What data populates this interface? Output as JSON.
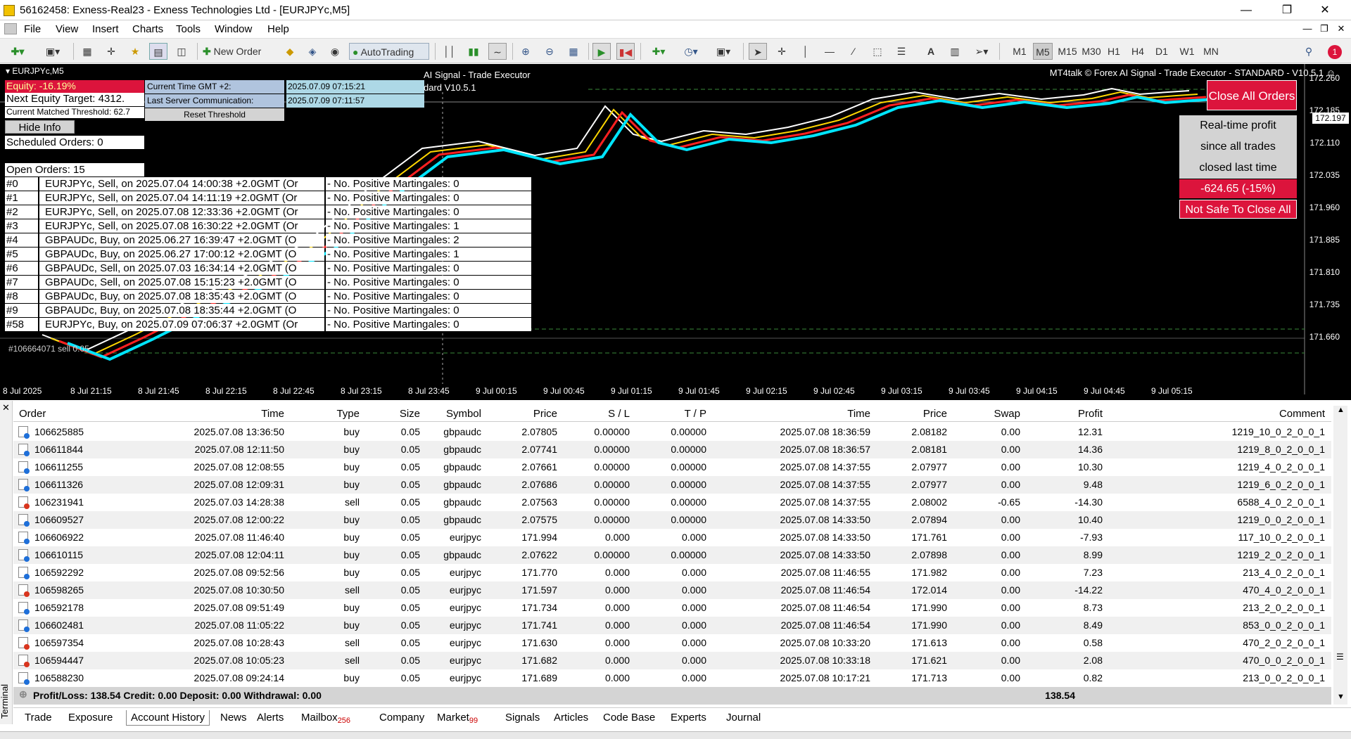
{
  "window": {
    "title": "56162458: Exness-Real23 - Exness Technologies Ltd - [EURJPYc,M5]"
  },
  "menu": [
    "File",
    "View",
    "Insert",
    "Charts",
    "Tools",
    "Window",
    "Help"
  ],
  "toolbar": {
    "new_order": "New Order",
    "autotrading": "AutoTrading",
    "timeframes": [
      "M1",
      "M5",
      "M15",
      "M30",
      "H1",
      "H4",
      "D1",
      "W1",
      "MN"
    ],
    "active_timeframe": "M5",
    "notification_count": "1"
  },
  "chart": {
    "symbol_title": "EURJPYc,M5",
    "header_right": "MT4talk © Forex AI Signal - Trade Executor - STANDARD - V10.5.1",
    "equity": "Equity: -16.19%",
    "next_equity_target": "Next Equity Target: 4312.",
    "current_threshold": "Current Matched Threshold: 62.7",
    "gmt_label": "Current Time GMT +2:",
    "gmt_value": "2025.07.09 07:15:21",
    "server_label": "Last Server Communication:",
    "server_value": "2025.07.09 07:11:57",
    "reset_threshold": "Reset Threshold",
    "ai_signal_title": "AI Signal - Trade Executor",
    "ai_signal_version": "dard V10.5.1",
    "hide_info": "Hide Info",
    "scheduled_orders": "Scheduled Orders: 0",
    "open_orders": "Open Orders: 15",
    "orders": [
      {
        "id": "#0",
        "desc": "EURJPYc, Sell, on 2025.07.04 14:00:38 +2.0GMT  (Or",
        "mart": " - No. Positive Martingales: 0"
      },
      {
        "id": "#1",
        "desc": "EURJPYc, Sell, on 2025.07.04 14:11:19 +2.0GMT  (Or",
        "mart": " - No. Positive Martingales: 0"
      },
      {
        "id": "#2",
        "desc": "EURJPYc, Sell, on 2025.07.08 12:33:36 +2.0GMT  (Or",
        "mart": " - No. Positive Martingales: 0"
      },
      {
        "id": "#3",
        "desc": "EURJPYc, Sell, on 2025.07.08 16:30:22 +2.0GMT  (Or",
        "mart": " - No. Positive Martingales: 1"
      },
      {
        "id": "#4",
        "desc": "GBPAUDc, Buy, on 2025.06.27 16:39:47 +2.0GMT  (O",
        "mart": " - No. Positive Martingales: 2"
      },
      {
        "id": "#5",
        "desc": "GBPAUDc, Buy, on 2025.06.27 17:00:12 +2.0GMT  (O",
        "mart": " - No. Positive Martingales: 1"
      },
      {
        "id": "#6",
        "desc": "GBPAUDc, Sell, on 2025.07.03 16:34:14 +2.0GMT  (O",
        "mart": " - No. Positive Martingales: 0"
      },
      {
        "id": "#7",
        "desc": "GBPAUDc, Sell, on 2025.07.08 15:15:23 +2.0GMT  (O",
        "mart": " - No. Positive Martingales: 0"
      },
      {
        "id": "#8",
        "desc": "GBPAUDc, Buy, on 2025.07.08 18:35:43 +2.0GMT  (O",
        "mart": " - No. Positive Martingales: 0"
      },
      {
        "id": "#9",
        "desc": "GBPAUDc, Buy, on 2025.07.08 18:35:44 +2.0GMT  (O",
        "mart": " - No. Positive Martingales: 0"
      },
      {
        "id": "#58",
        "desc": "EURJPYc, Buy, on 2025.07.09 07:06:37 +2.0GMT  (Or",
        "mart": " - No. Positive Martingales: 0"
      }
    ],
    "close_all_orders": "Close All Orders",
    "realtime_profit_lines": [
      "Real-time profit",
      "since all trades",
      "closed last time"
    ],
    "realtime_profit_value": "-624.65 (-15%)",
    "not_safe": "Not Safe To Close All",
    "current_price": "172.197",
    "price_axis": [
      "172.260",
      "172.185",
      "172.110",
      "172.035",
      "171.960",
      "171.885",
      "171.810",
      "171.735",
      "171.660"
    ],
    "time_axis": [
      "8 Jul 2025",
      "8 Jul 21:15",
      "8 Jul 21:45",
      "8 Jul 22:15",
      "8 Jul 22:45",
      "8 Jul 23:15",
      "8 Jul 23:45",
      "9 Jul 00:15",
      "9 Jul 00:45",
      "9 Jul 01:15",
      "9 Jul 01:45",
      "9 Jul 02:15",
      "9 Jul 02:45",
      "9 Jul 03:15",
      "9 Jul 03:45",
      "9 Jul 04:15",
      "9 Jul 04:45",
      "9 Jul 05:15"
    ],
    "ticket_label": "#106664071 sell 0.05"
  },
  "terminal": {
    "side_label": "Terminal",
    "columns": [
      "Order",
      "Time",
      "Type",
      "Size",
      "Symbol",
      "Price",
      "S / L",
      "T / P",
      "Time",
      "Price",
      "Swap",
      "Profit",
      "Comment"
    ],
    "rows": [
      {
        "order": "106625885",
        "open_time": "2025.07.08 13:36:50",
        "type": "buy",
        "size": "0.05",
        "symbol": "gbpaudc",
        "price": "2.07805",
        "sl": "0.00000",
        "tp": "0.00000",
        "close_time": "2025.07.08 18:36:59",
        "close_price": "2.08182",
        "swap": "0.00",
        "profit": "12.31",
        "comment": "1219_10_0_2_0_0_1"
      },
      {
        "order": "106611844",
        "open_time": "2025.07.08 12:11:50",
        "type": "buy",
        "size": "0.05",
        "symbol": "gbpaudc",
        "price": "2.07741",
        "sl": "0.00000",
        "tp": "0.00000",
        "close_time": "2025.07.08 18:36:57",
        "close_price": "2.08181",
        "swap": "0.00",
        "profit": "14.36",
        "comment": "1219_8_0_2_0_0_1"
      },
      {
        "order": "106611255",
        "open_time": "2025.07.08 12:08:55",
        "type": "buy",
        "size": "0.05",
        "symbol": "gbpaudc",
        "price": "2.07661",
        "sl": "0.00000",
        "tp": "0.00000",
        "close_time": "2025.07.08 14:37:55",
        "close_price": "2.07977",
        "swap": "0.00",
        "profit": "10.30",
        "comment": "1219_4_0_2_0_0_1"
      },
      {
        "order": "106611326",
        "open_time": "2025.07.08 12:09:31",
        "type": "buy",
        "size": "0.05",
        "symbol": "gbpaudc",
        "price": "2.07686",
        "sl": "0.00000",
        "tp": "0.00000",
        "close_time": "2025.07.08 14:37:55",
        "close_price": "2.07977",
        "swap": "0.00",
        "profit": "9.48",
        "comment": "1219_6_0_2_0_0_1"
      },
      {
        "order": "106231941",
        "open_time": "2025.07.03 14:28:38",
        "type": "sell",
        "size": "0.05",
        "symbol": "gbpaudc",
        "price": "2.07563",
        "sl": "0.00000",
        "tp": "0.00000",
        "close_time": "2025.07.08 14:37:55",
        "close_price": "2.08002",
        "swap": "-0.65",
        "profit": "-14.30",
        "comment": "6588_4_0_2_0_0_1"
      },
      {
        "order": "106609527",
        "open_time": "2025.07.08 12:00:22",
        "type": "buy",
        "size": "0.05",
        "symbol": "gbpaudc",
        "price": "2.07575",
        "sl": "0.00000",
        "tp": "0.00000",
        "close_time": "2025.07.08 14:33:50",
        "close_price": "2.07894",
        "swap": "0.00",
        "profit": "10.40",
        "comment": "1219_0_0_2_0_0_1"
      },
      {
        "order": "106606922",
        "open_time": "2025.07.08 11:46:40",
        "type": "buy",
        "size": "0.05",
        "symbol": "eurjpyc",
        "price": "171.994",
        "sl": "0.000",
        "tp": "0.000",
        "close_time": "2025.07.08 14:33:50",
        "close_price": "171.761",
        "swap": "0.00",
        "profit": "-7.93",
        "comment": "117_10_0_2_0_0_1"
      },
      {
        "order": "106610115",
        "open_time": "2025.07.08 12:04:11",
        "type": "buy",
        "size": "0.05",
        "symbol": "gbpaudc",
        "price": "2.07622",
        "sl": "0.00000",
        "tp": "0.00000",
        "close_time": "2025.07.08 14:33:50",
        "close_price": "2.07898",
        "swap": "0.00",
        "profit": "8.99",
        "comment": "1219_2_0_2_0_0_1"
      },
      {
        "order": "106592292",
        "open_time": "2025.07.08 09:52:56",
        "type": "buy",
        "size": "0.05",
        "symbol": "eurjpyc",
        "price": "171.770",
        "sl": "0.000",
        "tp": "0.000",
        "close_time": "2025.07.08 11:46:55",
        "close_price": "171.982",
        "swap": "0.00",
        "profit": "7.23",
        "comment": "213_4_0_2_0_0_1"
      },
      {
        "order": "106598265",
        "open_time": "2025.07.08 10:30:50",
        "type": "sell",
        "size": "0.05",
        "symbol": "eurjpyc",
        "price": "171.597",
        "sl": "0.000",
        "tp": "0.000",
        "close_time": "2025.07.08 11:46:54",
        "close_price": "172.014",
        "swap": "0.00",
        "profit": "-14.22",
        "comment": "470_4_0_2_0_0_1"
      },
      {
        "order": "106592178",
        "open_time": "2025.07.08 09:51:49",
        "type": "buy",
        "size": "0.05",
        "symbol": "eurjpyc",
        "price": "171.734",
        "sl": "0.000",
        "tp": "0.000",
        "close_time": "2025.07.08 11:46:54",
        "close_price": "171.990",
        "swap": "0.00",
        "profit": "8.73",
        "comment": "213_2_0_2_0_0_1"
      },
      {
        "order": "106602481",
        "open_time": "2025.07.08 11:05:22",
        "type": "buy",
        "size": "0.05",
        "symbol": "eurjpyc",
        "price": "171.741",
        "sl": "0.000",
        "tp": "0.000",
        "close_time": "2025.07.08 11:46:54",
        "close_price": "171.990",
        "swap": "0.00",
        "profit": "8.49",
        "comment": "853_0_0_2_0_0_1"
      },
      {
        "order": "106597354",
        "open_time": "2025.07.08 10:28:43",
        "type": "sell",
        "size": "0.05",
        "symbol": "eurjpyc",
        "price": "171.630",
        "sl": "0.000",
        "tp": "0.000",
        "close_time": "2025.07.08 10:33:20",
        "close_price": "171.613",
        "swap": "0.00",
        "profit": "0.58",
        "comment": "470_2_0_2_0_0_1"
      },
      {
        "order": "106594447",
        "open_time": "2025.07.08 10:05:23",
        "type": "sell",
        "size": "0.05",
        "symbol": "eurjpyc",
        "price": "171.682",
        "sl": "0.000",
        "tp": "0.000",
        "close_time": "2025.07.08 10:33:18",
        "close_price": "171.621",
        "swap": "0.00",
        "profit": "2.08",
        "comment": "470_0_0_2_0_0_1"
      },
      {
        "order": "106588230",
        "open_time": "2025.07.08 09:24:14",
        "type": "buy",
        "size": "0.05",
        "symbol": "eurjpyc",
        "price": "171.689",
        "sl": "0.000",
        "tp": "0.000",
        "close_time": "2025.07.08 10:17:21",
        "close_price": "171.713",
        "swap": "0.00",
        "profit": "0.82",
        "comment": "213_0_0_2_0_0_1"
      }
    ],
    "summary": "Profit/Loss: 138.54  Credit: 0.00  Deposit: 0.00  Withdrawal: 0.00",
    "summary_total": "138.54",
    "tabs": [
      {
        "label": "Trade",
        "badge": ""
      },
      {
        "label": "Exposure",
        "badge": ""
      },
      {
        "label": "Account History",
        "badge": ""
      },
      {
        "label": "News",
        "badge": ""
      },
      {
        "label": "Alerts",
        "badge": ""
      },
      {
        "label": "Mailbox",
        "badge": "256"
      },
      {
        "label": "Company",
        "badge": ""
      },
      {
        "label": "Market",
        "badge": "99"
      },
      {
        "label": "Signals",
        "badge": ""
      },
      {
        "label": "Articles",
        "badge": ""
      },
      {
        "label": "Code Base",
        "badge": ""
      },
      {
        "label": "Experts",
        "badge": ""
      },
      {
        "label": "Journal",
        "badge": ""
      }
    ],
    "active_tab": "Account History"
  },
  "colors": {
    "buy_icon": "#1e6fd9",
    "sell_icon": "#d9351e",
    "alert_red": "#dc143c"
  }
}
